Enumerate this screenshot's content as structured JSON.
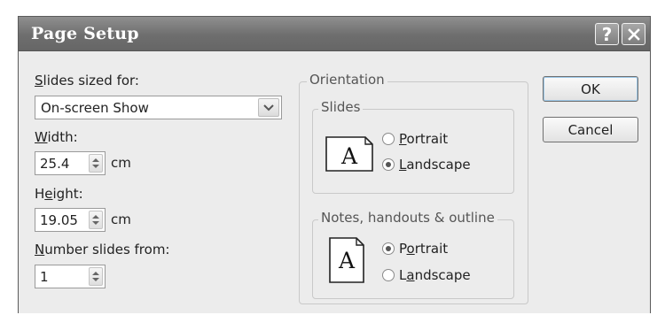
{
  "dialog": {
    "title": "Page Setup",
    "help_label": "?"
  },
  "slides_sized_for": {
    "label_hotkey": "S",
    "label_rest": "lides sized for:",
    "value": "On-screen Show"
  },
  "width": {
    "label_hotkey": "W",
    "label_rest": "idth:",
    "value": "25.4",
    "unit": "cm"
  },
  "height": {
    "label_pre": "H",
    "label_hotkey": "e",
    "label_rest": "ight:",
    "value": "19.05",
    "unit": "cm"
  },
  "number_slides_from": {
    "label_hotkey": "N",
    "label_rest": "umber slides from:",
    "value": "1"
  },
  "orientation": {
    "title": "Orientation",
    "slides": {
      "title": "Slides",
      "icon_letter": "A",
      "portrait": {
        "pre": "",
        "hotkey": "P",
        "rest": "ortrait",
        "selected": false
      },
      "landscape": {
        "pre": "",
        "hotkey": "L",
        "rest": "andscape",
        "selected": true
      }
    },
    "notes": {
      "title": "Notes, handouts & outline",
      "icon_letter": "A",
      "portrait": {
        "pre": "P",
        "hotkey": "o",
        "rest": "rtrait",
        "selected": true
      },
      "landscape": {
        "pre": "L",
        "hotkey": "a",
        "rest": "ndscape",
        "selected": false
      }
    }
  },
  "buttons": {
    "ok": "OK",
    "cancel": "Cancel"
  }
}
